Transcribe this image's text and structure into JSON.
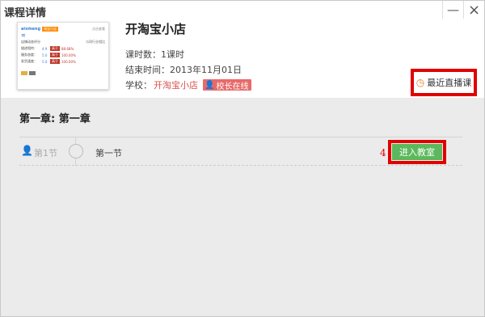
{
  "window": {
    "title": "课程详情",
    "controls": {
      "minimize": "—",
      "close": "×"
    }
  },
  "course": {
    "title": "开淘宝小店",
    "hours_label": "课时数：",
    "hours_value": "1课时",
    "end_label": "结束时间：",
    "end_value": "2013年11月01日",
    "school_label": "学校：",
    "school_name": "开淘宝小店",
    "principal_badge": "校长在线"
  },
  "thumbnail": {
    "brand": "aixmeng",
    "tag": "淘宝小店",
    "link": "点击查看",
    "summary_label": "店铺动态评分",
    "summary_right": "与同行业相比",
    "rows": [
      {
        "label": "描述相符：",
        "score": "4.9",
        "badge": "高于",
        "pct": "88.68%"
      },
      {
        "label": "服务态度：",
        "score": "5.0",
        "badge": "高于",
        "pct": "100.00%"
      },
      {
        "label": "发货速度：",
        "score": "5.0",
        "badge": "高于",
        "pct": "100.00%"
      }
    ]
  },
  "recent_live": {
    "label": "最近直播课"
  },
  "chapter": {
    "title": "第一章: 第一章",
    "lessons": [
      {
        "tag": "第1节",
        "name": "第一节",
        "step": "4",
        "enter_label": "进入教室"
      }
    ]
  },
  "colors": {
    "highlight": "#e00000",
    "enter_button": "#5cb85c",
    "school_link": "#d9534f",
    "badge": "#e86a6a"
  }
}
